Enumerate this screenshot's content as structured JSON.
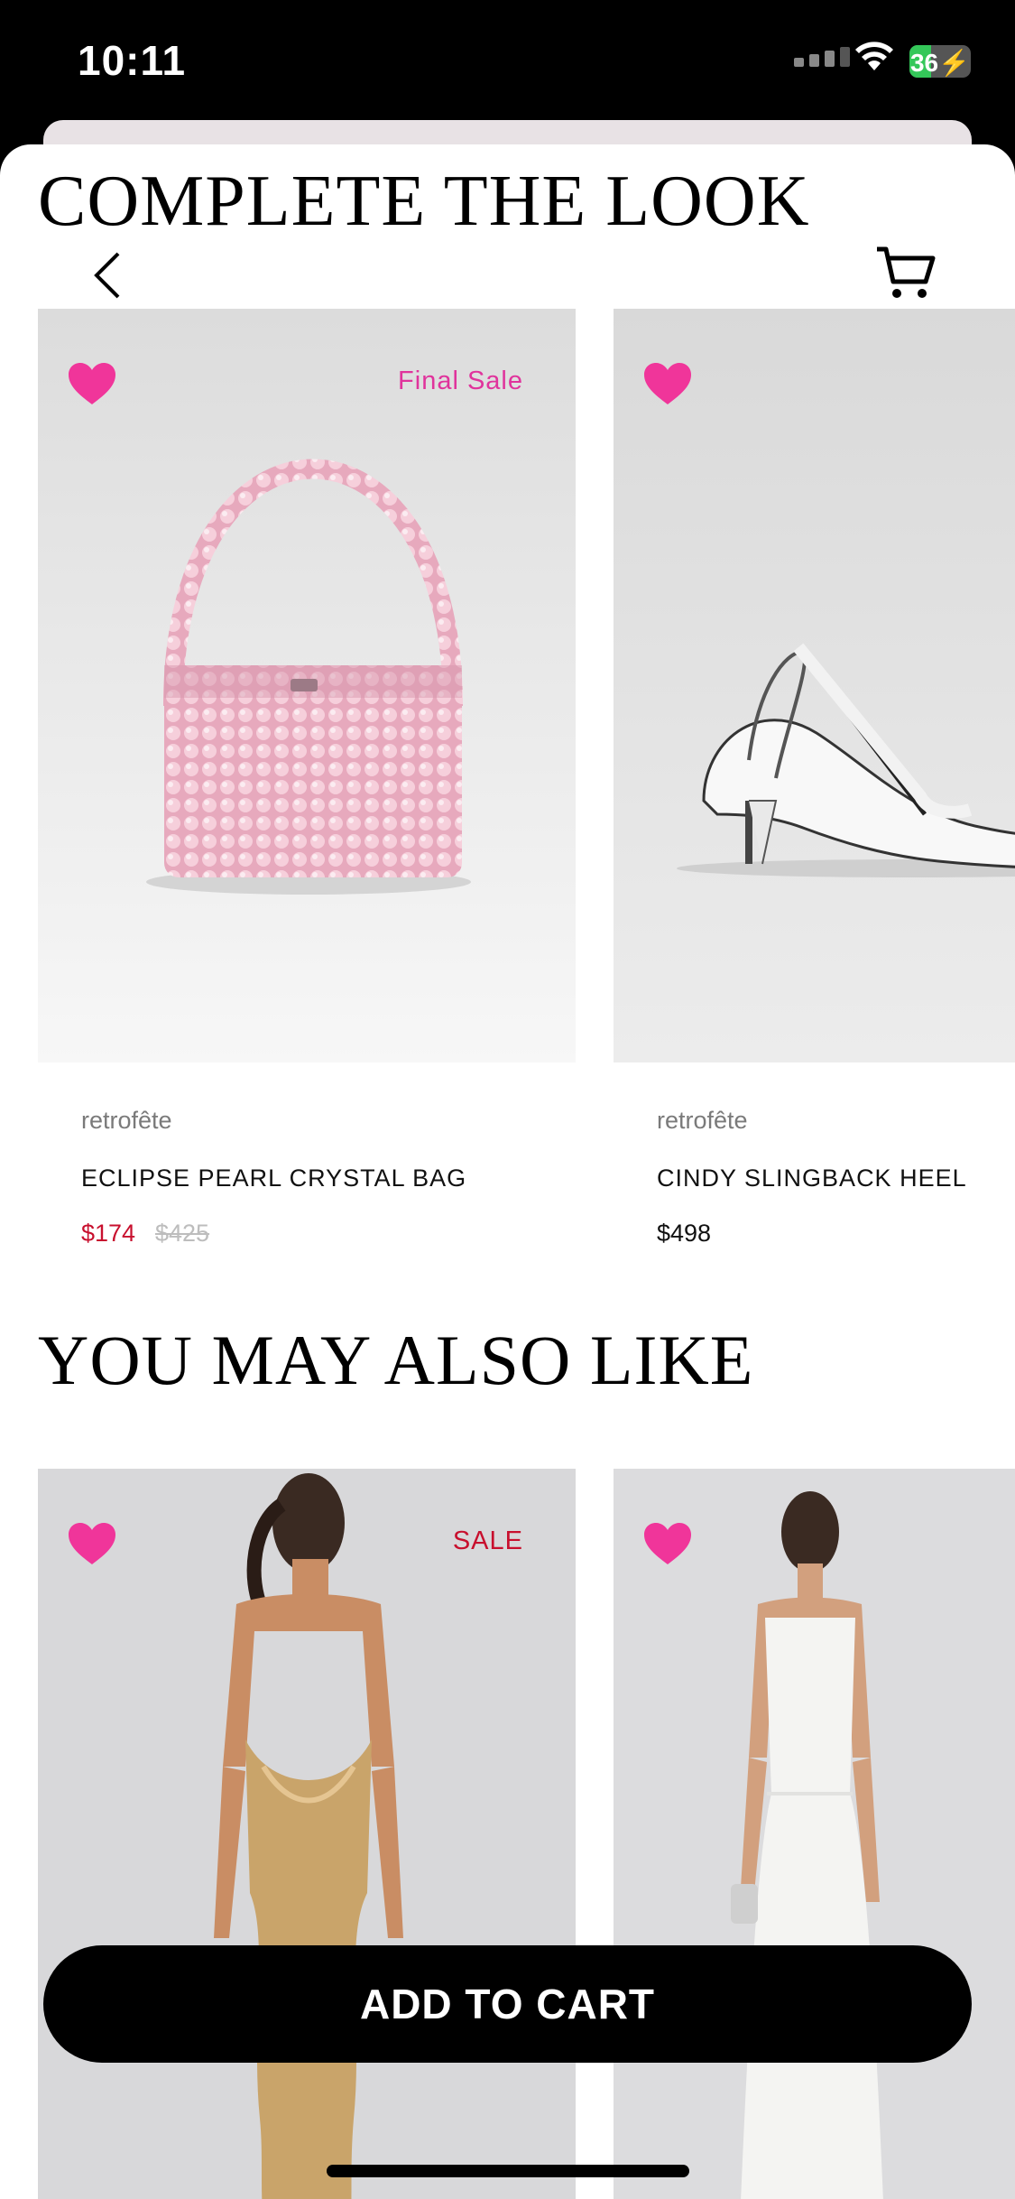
{
  "status_bar": {
    "time": "10:11",
    "battery": "36",
    "battery_level": 0.36
  },
  "sections": {
    "complete_the_look": "COMPLETE THE LOOK",
    "you_may_also_like": "YOU MAY ALSO LIKE"
  },
  "complete_the_look": [
    {
      "tag": "Final Sale",
      "brand": "retrofête",
      "name": "ECLIPSE PEARL CRYSTAL BAG",
      "price": "$174",
      "original_price": "$425"
    },
    {
      "brand": "retrofête",
      "name": "CINDY SLINGBACK HEEL",
      "price": "$498"
    }
  ],
  "you_may_also_like": [
    {
      "tag": "SALE"
    },
    {}
  ],
  "colors": {
    "accent_pink": "#f0359a",
    "sale_red": "#c8102e",
    "final_sale_pink": "#e0339c"
  },
  "add_to_cart": "ADD TO CART"
}
